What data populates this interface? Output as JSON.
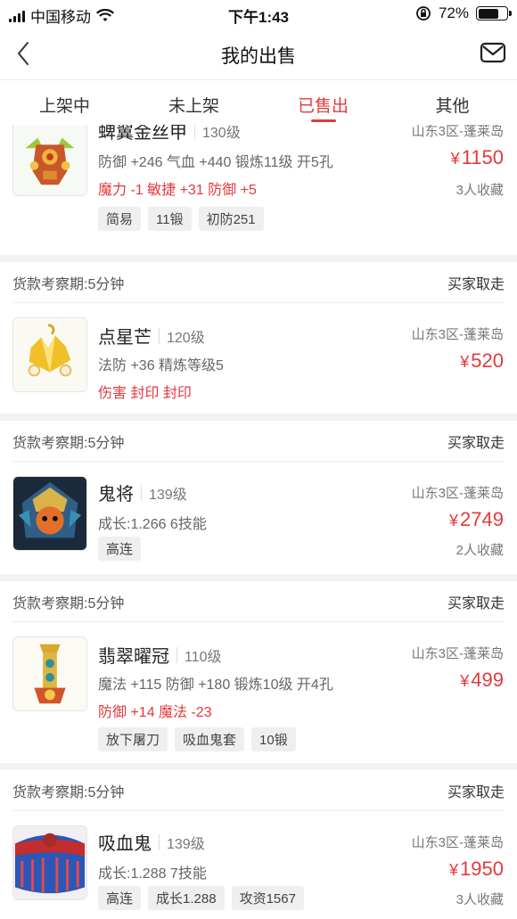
{
  "status_bar": {
    "carrier": "中国移动",
    "time": "下午1:43",
    "battery": "72%",
    "battery_level": 0.72
  },
  "nav": {
    "title": "我的出售"
  },
  "tabs": [
    {
      "label": "上架中"
    },
    {
      "label": "未上架"
    },
    {
      "label": "已售出"
    },
    {
      "label": "其他"
    }
  ],
  "active_tab": "已售出",
  "items": [
    {
      "name": "蜱翼金丝甲",
      "level": "130级",
      "server": "山东3区-蓬莱岛",
      "stats": "防御 +246 气血 +440 锻炼11级 开5孔",
      "attrs": "魔力 -1 敏捷 +31 防御 +5",
      "price": "1150",
      "favorites": "3人收藏",
      "tags": [
        "简易",
        "11锻",
        "初防251"
      ]
    },
    {
      "period": "货款考察期:5分钟",
      "status": "买家取走",
      "name": "点星芒",
      "level": "120级",
      "server": "山东3区-蓬莱岛",
      "stats": "法防 +36 精炼等级5",
      "attrs": "伤害 封印 封印",
      "price": "520"
    },
    {
      "period": "货款考察期:5分钟",
      "status": "买家取走",
      "name": "鬼将",
      "level": "139级",
      "server": "山东3区-蓬莱岛",
      "stats": "成长:1.266 6技能",
      "price": "2749",
      "favorites": "2人收藏",
      "tags": [
        "高连"
      ]
    },
    {
      "period": "货款考察期:5分钟",
      "status": "买家取走",
      "name": "翡翠曜冠",
      "level": "110级",
      "server": "山东3区-蓬莱岛",
      "stats": "魔法 +115 防御 +180 锻炼10级 开4孔",
      "attrs": "防御 +14 魔法 -23",
      "price": "499",
      "tags": [
        "放下屠刀",
        "吸血鬼套",
        "10锻"
      ]
    },
    {
      "period": "货款考察期:5分钟",
      "status": "买家取走",
      "name": "吸血鬼",
      "level": "139级",
      "server": "山东3区-蓬莱岛",
      "stats": "成长:1.288 7技能",
      "price": "1950",
      "favorites": "3人收藏",
      "tags": [
        "高连",
        "成长1.288",
        "攻资1567"
      ]
    }
  ],
  "currency_symbol": "¥",
  "colors": {
    "accent": "#e4393c",
    "divider": "#f2f2f2"
  }
}
